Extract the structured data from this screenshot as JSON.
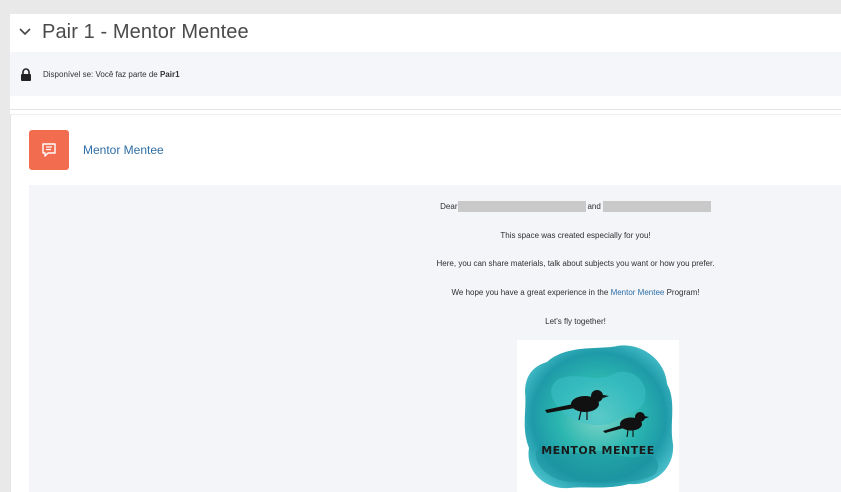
{
  "section": {
    "title": "Pair 1 - Mentor Mentee",
    "toggle_icon": "chevron-down-icon"
  },
  "restriction": {
    "icon": "lock-icon",
    "prefix": "Disponível se: Você faz parte de ",
    "group": "Pair1"
  },
  "activity": {
    "icon": "forum-icon",
    "icon_color": "#f26d4f",
    "name": "Mentor Mentee"
  },
  "message": {
    "greeting_start": "Dear",
    "greeting_and": "and",
    "line2": "This space was created especially for you!",
    "line3": "Here, you can share materials, talk about subjects you want or how you prefer.",
    "line4_before": "We hope you have a great experience in the ",
    "line4_link": "Mentor Mentee",
    "line4_after": " Program!",
    "line5": "Let's fly together!"
  },
  "logo": {
    "text": "MENTOR MENTEE",
    "colors": [
      "#2bb6b0",
      "#4fc4d0",
      "#1e9aa8",
      "#7fd6c8"
    ]
  },
  "colors": {
    "link": "#2f6fa6",
    "panel_bg": "#f3f5f8",
    "redaction": "#c9c9c9"
  }
}
